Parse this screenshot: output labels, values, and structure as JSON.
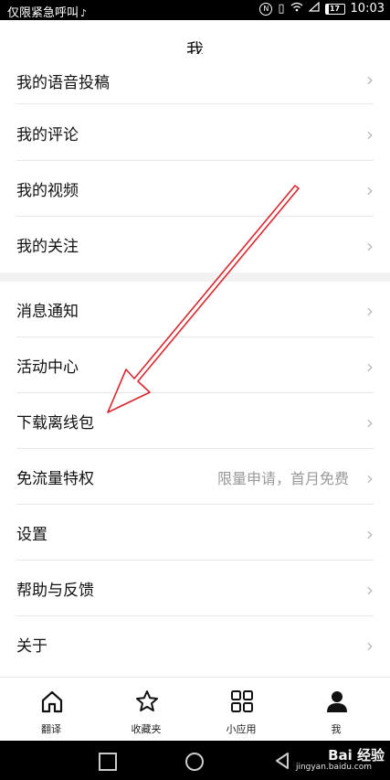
{
  "status_bar": {
    "carrier": "仅限紧急呼叫",
    "tiktok_icon": "tiktok-icon",
    "time": "10:03",
    "battery": "17"
  },
  "header": {
    "title": "我"
  },
  "menu": {
    "group1": [
      {
        "label": "我的语音投稿"
      },
      {
        "label": "我的评论"
      },
      {
        "label": "我的视频"
      },
      {
        "label": "我的关注"
      }
    ],
    "group2": [
      {
        "label": "消息通知"
      },
      {
        "label": "活动中心"
      },
      {
        "label": "下载离线包"
      },
      {
        "label": "免流量特权",
        "value": "限量申请，首月免费"
      },
      {
        "label": "设置"
      },
      {
        "label": "帮助与反馈"
      },
      {
        "label": "关于"
      }
    ],
    "chevron": "›"
  },
  "tabbar": {
    "tabs": [
      {
        "label": "翻译",
        "icon": "home-icon"
      },
      {
        "label": "收藏夹",
        "icon": "star-icon"
      },
      {
        "label": "小应用",
        "icon": "grid-icon"
      },
      {
        "label": "我",
        "icon": "user-icon"
      }
    ]
  },
  "watermark": {
    "text": "Bai 经验",
    "sub": "jingyan.baidu.com"
  },
  "colors": {
    "annotation_arrow": "#d9272e",
    "divider": "#e8e8e8",
    "secondary_text": "#999999"
  }
}
